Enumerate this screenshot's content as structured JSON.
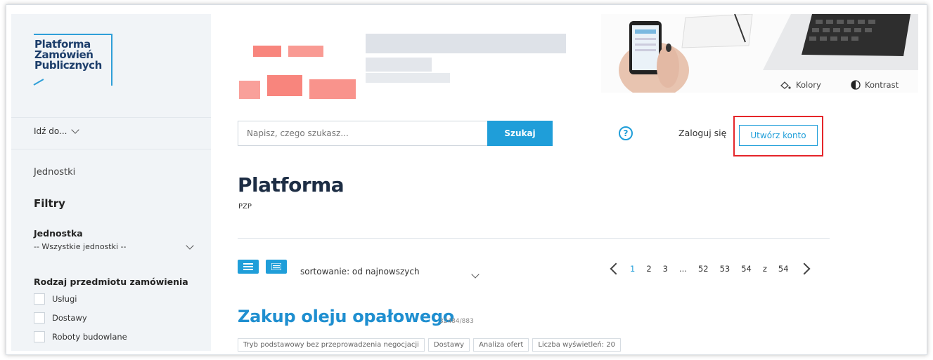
{
  "sidebar": {
    "logo_lines": [
      "Platforma",
      "Zamówień",
      "Publicznych"
    ],
    "goto_label": "Idź do...",
    "units_link": "Jednostki",
    "filters_heading": "Filtry",
    "unit_label": "Jednostka",
    "unit_select_value": "-- Wszystkie jednostki --",
    "order_type_label": "Rodzaj przedmiotu zamówienia",
    "order_types": [
      "Usługi",
      "Dostawy",
      "Roboty budowlane"
    ]
  },
  "header": {
    "colors_label": "Kolory",
    "contrast_label": "Kontrast",
    "search_placeholder": "Napisz, czego szukasz...",
    "search_button": "Szukaj",
    "help_symbol": "?",
    "login_label": "Zaloguj się",
    "create_account_label": "Utwórz konto"
  },
  "main": {
    "title": "Platforma",
    "subtitle": "PZP",
    "sort_label": "sortowanie: od najnowszych",
    "pagination": {
      "pages": [
        "1",
        "2",
        "3",
        "...",
        "52",
        "53",
        "54"
      ],
      "of_label": "z",
      "total": "54",
      "current": "1"
    },
    "item": {
      "title": "Zakup oleju opałowego",
      "id": "32484/883",
      "tags": [
        "Tryb podstawowy bez przeprowadzenia negocjacji",
        "Dostawy",
        "Analiza ofert",
        "Liczba wyświetleń: 20"
      ]
    }
  },
  "colors": {
    "accent": "#1f9ed9",
    "highlight_border": "#e5252a",
    "title_dark": "#1d2d44",
    "sidebar_bg": "#f1f4f7"
  }
}
